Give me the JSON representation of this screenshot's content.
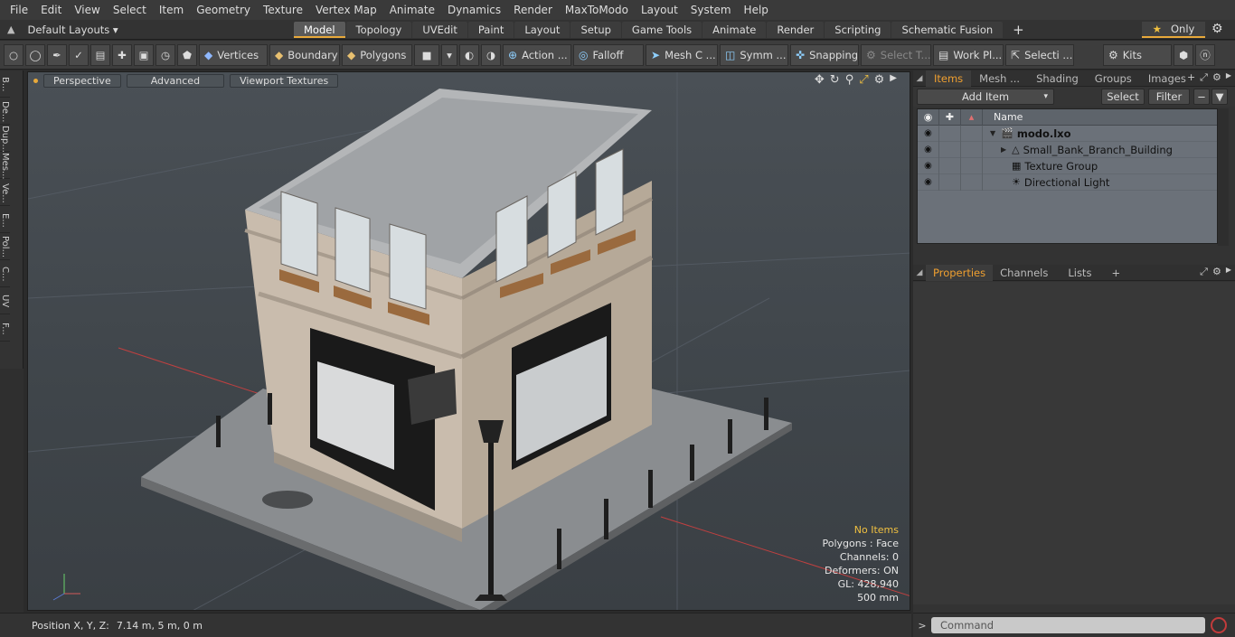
{
  "menu": [
    "File",
    "Edit",
    "View",
    "Select",
    "Item",
    "Geometry",
    "Texture",
    "Vertex Map",
    "Animate",
    "Dynamics",
    "Render",
    "MaxToModo",
    "Layout",
    "System",
    "Help"
  ],
  "layouts": {
    "label": "Default Layouts ▾"
  },
  "tabs": [
    "Model",
    "Topology",
    "UVEdit",
    "Paint",
    "Layout",
    "Setup",
    "Game Tools",
    "Animate",
    "Render",
    "Scripting",
    "Schematic Fusion"
  ],
  "active_tab": "Model",
  "only_label": "Only",
  "toolbar": {
    "vertices": "Vertices",
    "boundary": "Boundary",
    "polygons": "Polygons",
    "action": "Action",
    "falloff": "Falloff",
    "mesh": "Mesh C ...",
    "symm": "Symm ...",
    "snapping": "Snapping",
    "select_t": "Select T...",
    "work_pl": "Work Pl...",
    "selecti": "Selecti ...",
    "kits": "Kits"
  },
  "left_tabs": [
    "B...",
    "De...",
    "Dup...",
    "Mes...",
    "Ve...",
    "E...",
    "Pol...",
    "C...",
    "UV",
    "F..."
  ],
  "viewport": {
    "perspective": "Perspective",
    "advanced": "Advanced",
    "textures": "Viewport Textures",
    "stats": {
      "no_items": "No Items",
      "polygons": "Polygons : Face",
      "channels": "Channels: 0",
      "deformers": "Deformers: ON",
      "gl": "GL: 428,940",
      "scale": "500 mm"
    }
  },
  "status": {
    "label": "Position X, Y, Z:",
    "value": "7.14 m, 5 m, 0 m"
  },
  "items_panel": {
    "tabs": [
      "Items",
      "Mesh ...",
      "Shading",
      "Groups",
      "Images"
    ],
    "add_item": "Add Item",
    "select": "Select",
    "filter": "Filter",
    "name_col": "Name",
    "rows": [
      {
        "name": "modo.lxo",
        "bold": true
      },
      {
        "name": "Small_Bank_Branch_Building",
        "bold": false
      },
      {
        "name": "Texture Group",
        "bold": false
      },
      {
        "name": "Directional Light",
        "bold": false
      }
    ]
  },
  "props_panel": {
    "tabs": [
      "Properties",
      "Channels",
      "Lists"
    ]
  },
  "command": {
    "placeholder": "Command"
  }
}
